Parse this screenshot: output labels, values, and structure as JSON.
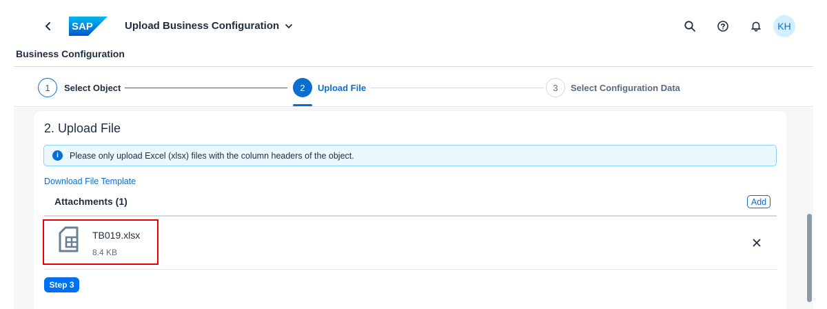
{
  "shell": {
    "app_title": "Upload Business Configuration",
    "logo_text": "SAP",
    "avatar_initials": "KH",
    "icons": [
      "back-icon",
      "search-icon",
      "help-icon",
      "bell-icon"
    ]
  },
  "page": {
    "header": "Business Configuration"
  },
  "wizard": {
    "steps": [
      {
        "number": "1",
        "label": "Select Object",
        "state": "completed"
      },
      {
        "number": "2",
        "label": "Upload File",
        "state": "active"
      },
      {
        "number": "3",
        "label": "Select Configuration Data",
        "state": "inactive"
      }
    ]
  },
  "section": {
    "title": "2. Upload File",
    "info_message": "Please only upload Excel (xlsx) files with the column headers of the object.",
    "download_link": "Download File Template",
    "attachments_title": "Attachments (1)",
    "add_label": "Add",
    "files": [
      {
        "name": "TB019.xlsx",
        "size": "8.4 KB"
      }
    ],
    "next_step_label": "Step 3"
  },
  "colors": {
    "accent": "#0a6ed1",
    "highlight": "#e60000",
    "info_bg": "#ebf8ff"
  }
}
